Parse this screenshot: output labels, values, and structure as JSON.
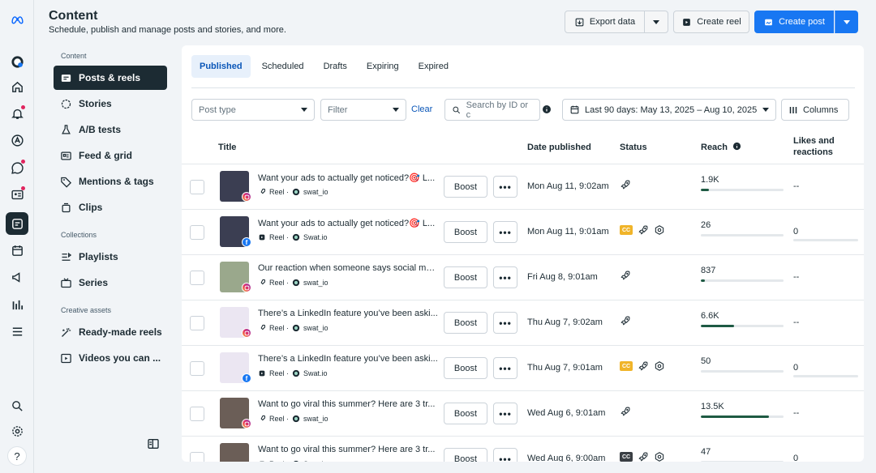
{
  "header": {
    "title": "Content",
    "subtitle": "Schedule, publish and manage posts and stories, and more.",
    "export_label": "Export data",
    "create_reel_label": "Create reel",
    "create_post_label": "Create post"
  },
  "nav": {
    "content_section": "Content",
    "collections_section": "Collections",
    "creative_section": "Creative assets",
    "items": [
      {
        "label": "Posts & reels"
      },
      {
        "label": "Stories"
      },
      {
        "label": "A/B tests"
      },
      {
        "label": "Feed & grid"
      },
      {
        "label": "Mentions & tags"
      },
      {
        "label": "Clips"
      },
      {
        "label": "Playlists"
      },
      {
        "label": "Series"
      },
      {
        "label": "Ready-made reels"
      },
      {
        "label": "Videos you can ..."
      }
    ]
  },
  "tabs": [
    "Published",
    "Scheduled",
    "Drafts",
    "Expiring",
    "Expired"
  ],
  "filters": {
    "post_type": "Post type",
    "filter": "Filter",
    "clear": "Clear",
    "search_placeholder": "Search by ID or c",
    "date_range": "Last 90 days: May 13, 2025 – Aug 10, 2025",
    "columns": "Columns"
  },
  "table": {
    "headers": {
      "title": "Title",
      "date": "Date published",
      "status": "Status",
      "reach": "Reach",
      "likes": "Likes and reactions"
    },
    "boost_label": "Boost",
    "more_label": "•••",
    "reel_label": "Reel ·",
    "rows": [
      {
        "title": "Want your ads to actually get noticed?🎯 L...",
        "account": "swat_io",
        "platform": "instagram",
        "date": "Mon Aug 11, 9:02am",
        "cc": false,
        "reach": "1.9K",
        "reach_fraction": 0.1,
        "likes": "--",
        "thumb": "#3b3e52"
      },
      {
        "title": "Want your ads to actually get noticed?🎯 L...",
        "account": "Swat.io",
        "platform": "facebook",
        "date": "Mon Aug 11, 9:01am",
        "cc": true,
        "cc_color": "#f0b429",
        "reach": "26",
        "reach_fraction": 0,
        "likes": "0",
        "thumb": "#3b3e52"
      },
      {
        "title": "Our reaction when someone says social me...",
        "account": "swat_io",
        "platform": "instagram",
        "date": "Fri Aug 8, 9:01am",
        "cc": false,
        "reach": "837",
        "reach_fraction": 0.05,
        "likes": "--",
        "thumb": "#9aa88c"
      },
      {
        "title": "There’s a LinkedIn feature you’ve been aski...",
        "account": "swat_io",
        "platform": "instagram",
        "date": "Thu Aug 7, 9:02am",
        "cc": false,
        "reach": "6.6K",
        "reach_fraction": 0.4,
        "likes": "--",
        "thumb": "#ebe6f2"
      },
      {
        "title": "There’s a LinkedIn feature you’ve been aski...",
        "account": "Swat.io",
        "platform": "facebook",
        "date": "Thu Aug 7, 9:01am",
        "cc": true,
        "cc_color": "#f0b429",
        "reach": "50",
        "reach_fraction": 0,
        "likes": "0",
        "thumb": "#ebe6f2"
      },
      {
        "title": "Want to go viral this summer? Here are 3 tr...",
        "account": "swat_io",
        "platform": "instagram",
        "date": "Wed Aug 6, 9:01am",
        "cc": false,
        "reach": "13.5K",
        "reach_fraction": 0.82,
        "likes": "--",
        "thumb": "#6b5e57"
      },
      {
        "title": "Want to go viral this summer? Here are 3 tr...",
        "account": "Swat.io",
        "platform": "facebook",
        "date": "Wed Aug 6, 9:00am",
        "cc": true,
        "cc_color": "#3a3f44",
        "reach": "47",
        "reach_fraction": 0,
        "likes": "0",
        "thumb": "#6b5e57"
      }
    ]
  },
  "colors": {
    "accent": "#1877f2",
    "nav_active": "#1c2b33",
    "reach_bar": "#1e5a43"
  }
}
